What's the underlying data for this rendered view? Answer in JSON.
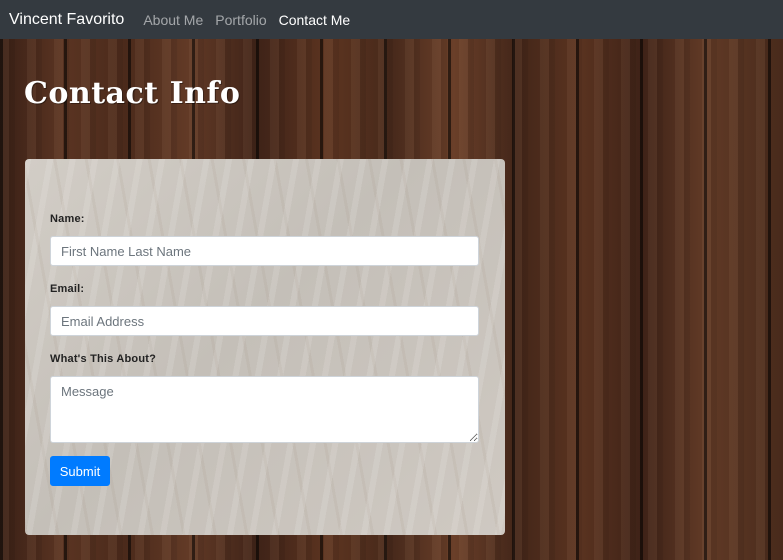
{
  "navbar": {
    "brand": "Vincent Favorito",
    "links": [
      {
        "label": "About Me",
        "active": false
      },
      {
        "label": "Portfolio",
        "active": false
      },
      {
        "label": "Contact Me",
        "active": true
      }
    ]
  },
  "page_title": "Contact Info",
  "form": {
    "name_label": "Name:",
    "name_placeholder": "First Name Last Name",
    "email_label": "Email:",
    "email_placeholder": "Email Address",
    "message_label": "What's This About?",
    "message_placeholder": "Message",
    "submit_label": "Submit"
  },
  "colors": {
    "navbar_bg": "#343a40",
    "submit_bg": "#007bff"
  }
}
